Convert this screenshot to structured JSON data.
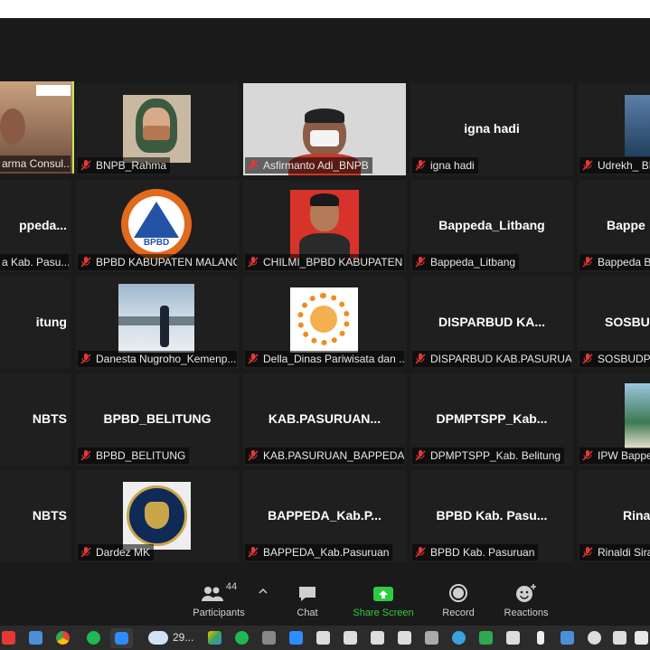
{
  "toolbar": {
    "participants_label": "Participants",
    "participants_count": "44",
    "chat_label": "Chat",
    "share_label": "Share Screen",
    "record_label": "Record",
    "reactions_label": "Reactions"
  },
  "taskbar": {
    "weather_temp": "29..."
  },
  "tiles": {
    "r1c0": {
      "label": "arma Consul..."
    },
    "r1c1": {
      "label": "BNPB_Rahma"
    },
    "r1c2": {
      "label": "Asfirmanto Adi_BNPB"
    },
    "r1c3": {
      "center": "igna hadi",
      "label": "igna hadi"
    },
    "r1c4": {
      "label": "Udrekh_ BN"
    },
    "r2c0": {
      "center": "ppeda...",
      "label": "a Kab. Pasu..."
    },
    "r2c1": {
      "label": "BPBD KABUPATEN MALANG",
      "logo_text": "BPBD"
    },
    "r2c2": {
      "label": "CHILMI_BPBD KABUPATEN ..."
    },
    "r2c3": {
      "center": "Bappeda_Litbang",
      "label": "Bappeda_Litbang"
    },
    "r2c4": {
      "center": "Bappe",
      "label": "Bappeda B"
    },
    "r3c0": {
      "center": "itung",
      "label": ""
    },
    "r3c1": {
      "label": "Danesta Nugroho_Kemenp..."
    },
    "r3c2": {
      "label": "Della_Dinas Pariwisata dan ..."
    },
    "r3c3": {
      "center": "DISPARBUD KA...",
      "label": "DISPARBUD KAB.PASURUA..."
    },
    "r3c4": {
      "center": "SOSBU",
      "label": "SOSBUDPE"
    },
    "r4c0": {
      "center": "NBTS",
      "label": ""
    },
    "r4c1": {
      "center": "BPBD_BELITUNG",
      "label": "BPBD_BELITUNG"
    },
    "r4c2": {
      "center": "KAB.PASURUAN...",
      "label": "KAB.PASURUAN_BAPPEDA_..."
    },
    "r4c3": {
      "center": "DPMPTSPP_Kab...",
      "label": "DPMPTSPP_Kab. Belitung"
    },
    "r4c4": {
      "label": "IPW Bappe"
    },
    "r5c0": {
      "center": "NBTS",
      "label": ""
    },
    "r5c1": {
      "label": "Dardez MK"
    },
    "r5c2": {
      "center": "BAPPEDA_Kab.P...",
      "label": "BAPPEDA_Kab.Pasuruan"
    },
    "r5c3": {
      "center": "BPBD Kab. Pasu...",
      "label": "BPBD Kab. Pasuruan"
    },
    "r5c4": {
      "center": "Rina",
      "label": "Rinaldi Sira"
    }
  },
  "colors": {
    "active_speaker": "#c6e85b",
    "share_green": "#2ecc40",
    "muted_red": "#e53935"
  }
}
